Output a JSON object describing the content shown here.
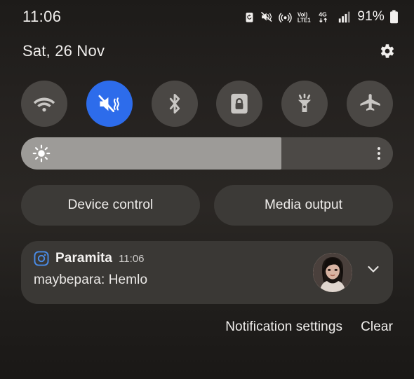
{
  "theme": {
    "background": "#231f1d",
    "accent": "#2d6ceb",
    "toggle_off": "#4a4744",
    "card": "#3a3835",
    "pill": "#3c3a37",
    "slider_track": "#4c4946",
    "slider_fill": "#9d9b98",
    "text": "#f1efed"
  },
  "statusbar": {
    "time": "11:06",
    "battery_percent": "91%",
    "icons": [
      {
        "name": "power-saving-icon",
        "label": "power saving"
      },
      {
        "name": "mute-vibrate-icon",
        "label": "sound off"
      },
      {
        "name": "hotspot-icon",
        "label": "mobile hotspot"
      },
      {
        "name": "volte-icon",
        "label": "VoLTE",
        "line1": "Vol)",
        "line2": "LTE1"
      },
      {
        "name": "network-4g-icon",
        "label": "4G data",
        "text": "4G"
      },
      {
        "name": "signal-bars-icon",
        "label": "signal strength"
      },
      {
        "name": "battery-icon",
        "label": "battery"
      }
    ]
  },
  "header": {
    "date": "Sat, 26 Nov",
    "settings_icon": "gear-icon"
  },
  "quick_toggles": [
    {
      "id": "wifi",
      "label": "Wi-Fi",
      "icon": "wifi-icon",
      "active": false
    },
    {
      "id": "sound",
      "label": "Mute",
      "icon": "mute-vibrate-icon",
      "active": true
    },
    {
      "id": "bluetooth",
      "label": "Bluetooth",
      "icon": "bluetooth-icon",
      "active": false
    },
    {
      "id": "auto-rotate",
      "label": "Auto rotate",
      "icon": "screen-lock-rotation-icon",
      "active": false
    },
    {
      "id": "flashlight",
      "label": "Flashlight",
      "icon": "flashlight-icon",
      "active": false
    },
    {
      "id": "airplane",
      "label": "Flight mode",
      "icon": "airplane-icon",
      "active": false
    }
  ],
  "brightness": {
    "icon": "brightness-sun-icon",
    "value": 70,
    "fill_percent": "70%",
    "menu_icon": "overflow-menu-icon"
  },
  "shortcuts": [
    {
      "id": "device-control",
      "label": "Device control"
    },
    {
      "id": "media-output",
      "label": "Media output"
    }
  ],
  "notification": {
    "app_icon": "instagram-icon",
    "app_name": "Paramita",
    "time": "11:06",
    "body": "maybepara: Hemlo",
    "avatar": "contact-avatar",
    "expand_icon": "chevron-down-icon"
  },
  "footer": {
    "settings_label": "Notification settings",
    "clear_label": "Clear"
  }
}
